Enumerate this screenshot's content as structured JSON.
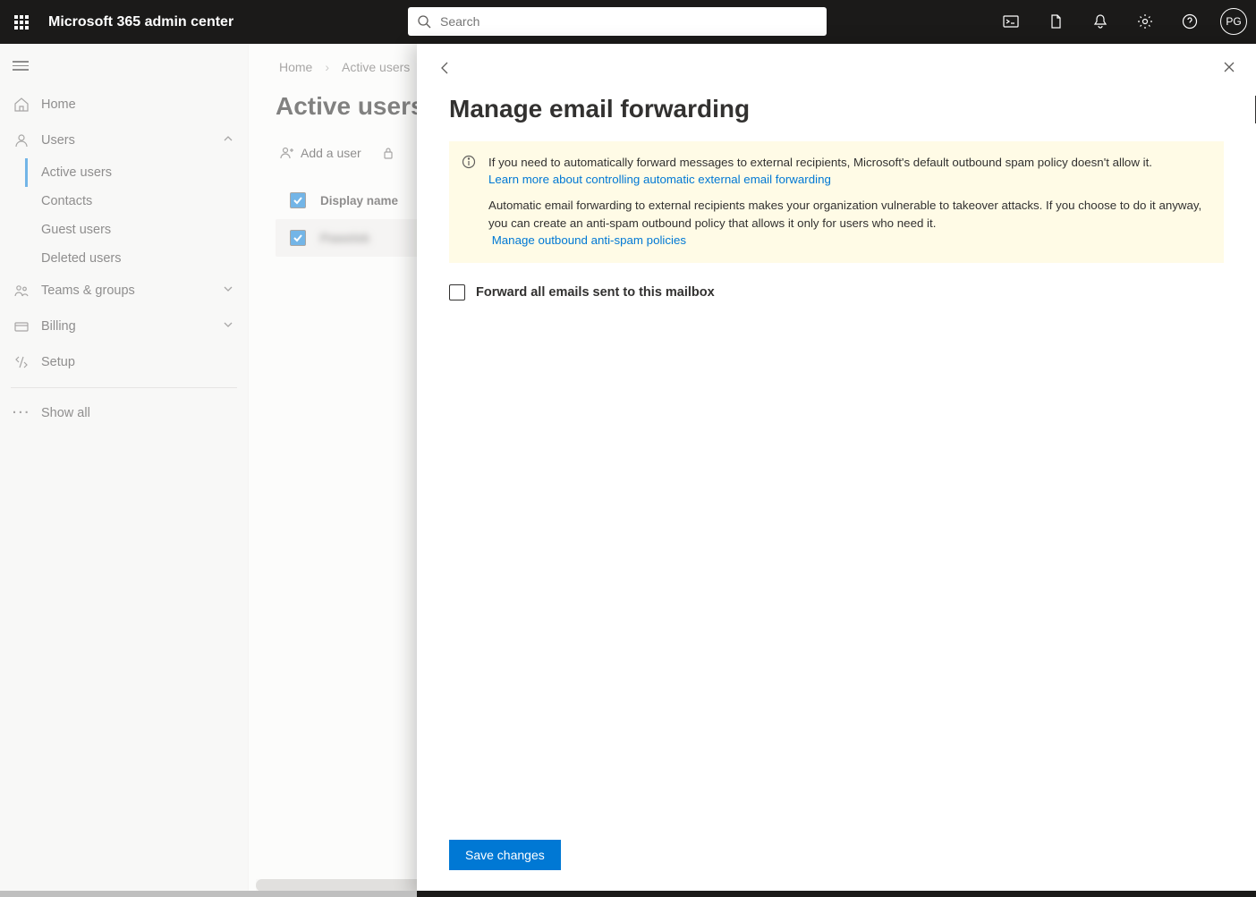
{
  "header": {
    "app_title": "Microsoft 365 admin center",
    "search_placeholder": "Search",
    "avatar_initials": "PG"
  },
  "sidebar": {
    "home": "Home",
    "users": "Users",
    "users_children": {
      "active": "Active users",
      "contacts": "Contacts",
      "guest": "Guest users",
      "deleted": "Deleted users"
    },
    "teams": "Teams & groups",
    "billing": "Billing",
    "setup": "Setup",
    "show_all": "Show all"
  },
  "breadcrumbs": {
    "home": "Home",
    "active_users": "Active users"
  },
  "page": {
    "title": "Active users"
  },
  "toolbar": {
    "add_user": "Add a user"
  },
  "table": {
    "col_display_name": "Display name",
    "row0_name": "Pawelek"
  },
  "panel": {
    "title": "Manage email forwarding",
    "banner_p1": "If you need to automatically forward messages to external recipients, Microsoft's default outbound spam policy doesn't allow it.",
    "banner_link1": "Learn more about controlling automatic external email forwarding",
    "banner_p2": "Automatic email forwarding to external recipients makes your organization vulnerable to takeover attacks. If you choose to do it anyway, you can create an anti-spam outbound policy that allows it only for users who need it.",
    "banner_link2": "Manage outbound anti-spam policies",
    "forward_label": "Forward all emails sent to this mailbox",
    "save": "Save changes"
  }
}
